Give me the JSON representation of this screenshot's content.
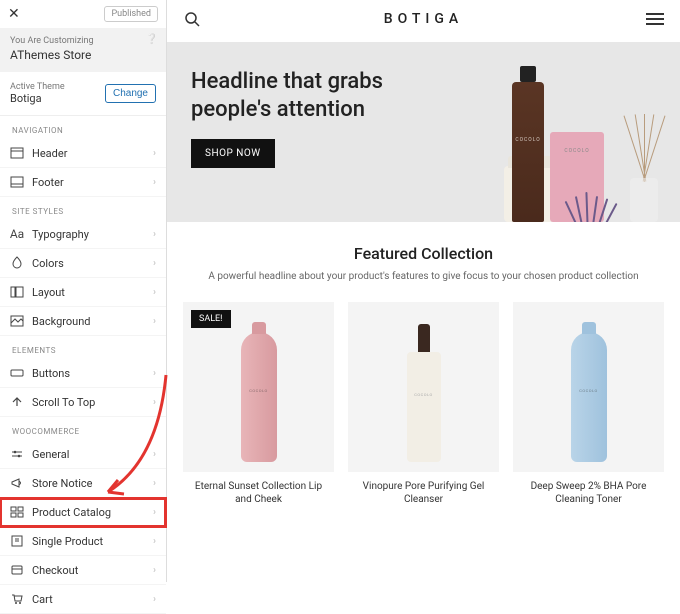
{
  "sidebar": {
    "close": "✕",
    "published": "Published",
    "customizing_label": "You Are Customizing",
    "site_name": "AThemes Store",
    "help": "❔",
    "active_theme_label": "Active Theme",
    "active_theme": "Botiga",
    "change": "Change",
    "sections": {
      "navigation": "NAVIGATION",
      "site_styles": "SITE STYLES",
      "elements": "ELEMENTS",
      "woocommerce": "WOOCOMMERCE"
    },
    "nav": {
      "header": "Header",
      "footer": "Footer"
    },
    "styles": {
      "typography": "Typography",
      "colors": "Colors",
      "layout": "Layout",
      "background": "Background"
    },
    "elements_items": {
      "buttons": "Buttons",
      "scroll_top": "Scroll To Top"
    },
    "woo": {
      "general": "General",
      "store_notice": "Store Notice",
      "product_catalog": "Product Catalog",
      "single_product": "Single Product",
      "checkout": "Checkout",
      "cart": "Cart"
    }
  },
  "preview": {
    "brand": "BOTIGA",
    "hero": {
      "headline": "Headline that grabs people's attention",
      "cta": "SHOP NOW"
    },
    "featured": {
      "title": "Featured Collection",
      "subtitle": "A powerful headline about your product's features to give focus to your chosen product collection"
    },
    "products": [
      {
        "sale": "SALE!",
        "name": "Eternal Sunset Collection Lip and Cheek"
      },
      {
        "sale": "",
        "name": "Vinopure Pore Purifying Gel Cleanser"
      },
      {
        "sale": "",
        "name": "Deep Sweep 2% BHA Pore Cleaning Toner"
      }
    ]
  }
}
